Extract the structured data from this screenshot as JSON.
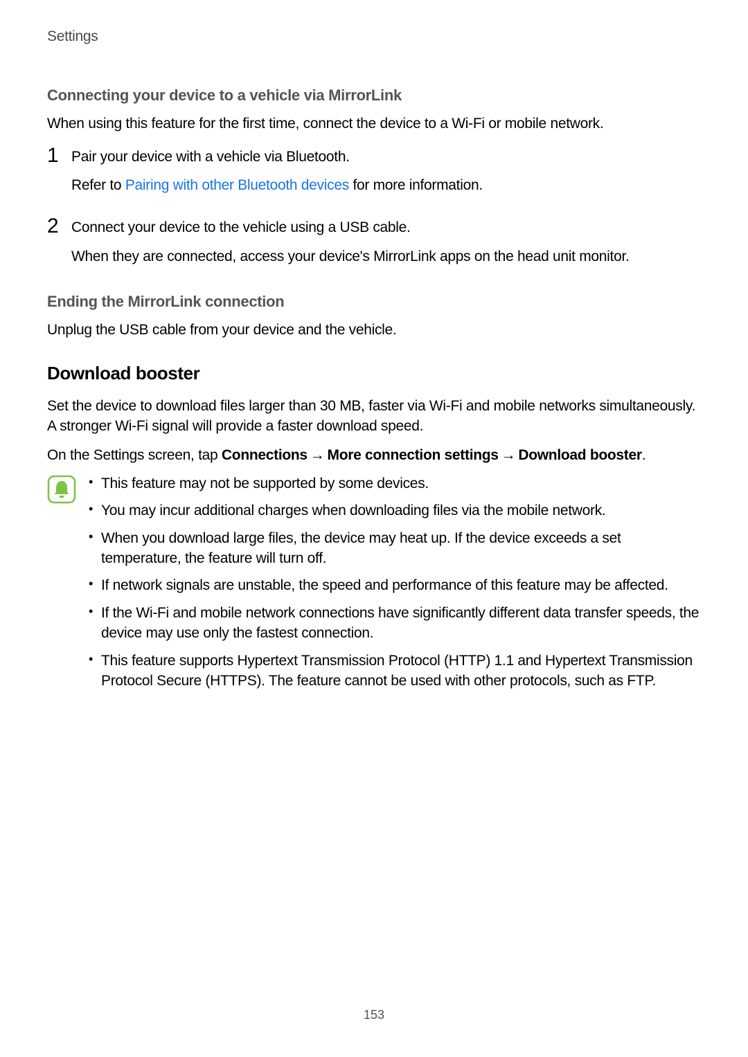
{
  "header": "Settings",
  "sec1": {
    "title": "Connecting your device to a vehicle via MirrorLink",
    "intro": "When using this feature for the first time, connect the device to a Wi-Fi or mobile network.",
    "steps": [
      {
        "num": "1",
        "line1": "Pair your device with a vehicle via Bluetooth.",
        "refer_prefix": "Refer to ",
        "refer_link": "Pairing with other Bluetooth devices",
        "refer_suffix": " for more information."
      },
      {
        "num": "2",
        "line1": "Connect your device to the vehicle using a USB cable.",
        "line2": "When they are connected, access your device's MirrorLink apps on the head unit monitor."
      }
    ]
  },
  "sec2": {
    "title": "Ending the MirrorLink connection",
    "body": "Unplug the USB cable from your device and the vehicle."
  },
  "sec3": {
    "title": "Download booster",
    "p1": "Set the device to download files larger than 30 MB, faster via Wi-Fi and mobile networks simultaneously. A stronger Wi-Fi signal will provide a faster download speed.",
    "p2_prefix": "On the Settings screen, tap ",
    "nav1": "Connections",
    "arrow": "→",
    "nav2": "More connection settings",
    "nav3": "Download booster",
    "p2_suffix": ".",
    "notes": [
      "This feature may not be supported by some devices.",
      "You may incur additional charges when downloading files via the mobile network.",
      "When you download large files, the device may heat up. If the device exceeds a set temperature, the feature will turn off.",
      "If network signals are unstable, the speed and performance of this feature may be affected.",
      "If the Wi-Fi and mobile network connections have significantly different data transfer speeds, the device may use only the fastest connection.",
      "This feature supports Hypertext Transmission Protocol (HTTP) 1.1 and Hypertext Transmission Protocol Secure (HTTPS). The feature cannot be used with other protocols, such as FTP."
    ]
  },
  "pageNumber": "153"
}
